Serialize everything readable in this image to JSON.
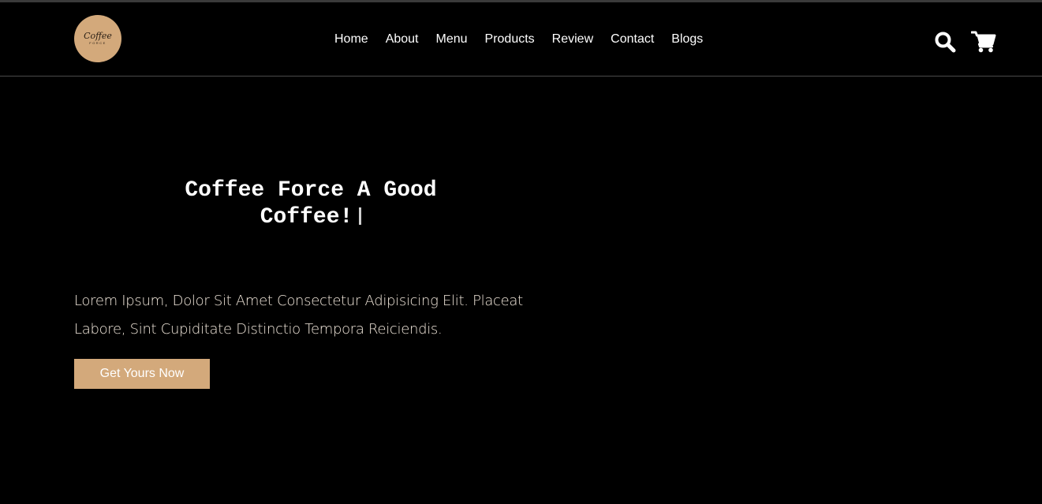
{
  "header": {
    "logo": {
      "script_text": "Coffee",
      "sub_text": "FORCE"
    },
    "nav": [
      {
        "label": "Home"
      },
      {
        "label": "About"
      },
      {
        "label": "Menu"
      },
      {
        "label": "Products"
      },
      {
        "label": "Review"
      },
      {
        "label": "Contact"
      },
      {
        "label": "Blogs"
      }
    ],
    "icons": {
      "search": "search-icon",
      "cart": "cart-icon"
    }
  },
  "hero": {
    "title_line1": "Coffee Force A Good",
    "title_line2": "Coffee!",
    "text": "Lorem Ipsum, Dolor Sit Amet Consectetur Adipisicing Elit. Placeat Labore, Sint Cupiditate Distinctio Tempora Reiciendis.",
    "cta_label": "Get Yours Now"
  },
  "colors": {
    "background": "#000000",
    "accent": "#d3a97b",
    "text": "#ffffff"
  }
}
